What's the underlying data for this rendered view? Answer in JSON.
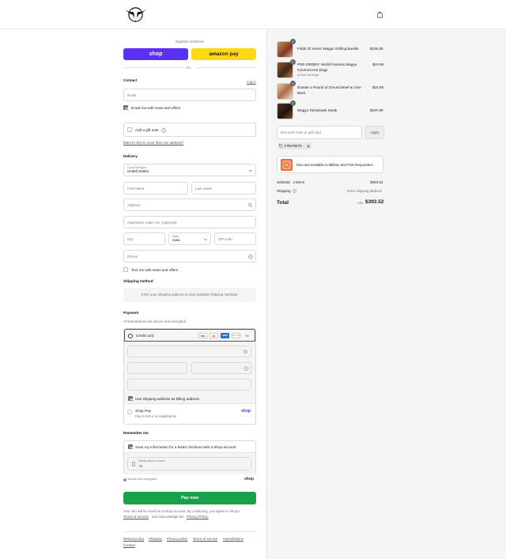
{
  "header": {
    "logo": "longhorn-logo",
    "cart_icon": "shopping-bag-icon"
  },
  "express": {
    "title": "Express checkout",
    "shop_label": "shop",
    "amazon_label": "amazon pay",
    "or_label": "OR"
  },
  "contact": {
    "title": "Contact",
    "login_label": "Log in",
    "email_placeholder": "Email",
    "email_news_label": "Email me with news and offers",
    "gift_note_label": "Add a gift note",
    "ship_multiple_link": "Want to ship to more than one address?"
  },
  "delivery": {
    "title": "Delivery",
    "country_label": "Country/Region",
    "country_value": "United States",
    "first_name_placeholder": "First name",
    "last_name_placeholder": "Last name",
    "address_placeholder": "Address",
    "apartment_placeholder": "Apartment, suite, etc. (optional)",
    "city_placeholder": "City",
    "state_label": "State",
    "state_value": "Iowa",
    "zip_placeholder": "ZIP code",
    "phone_placeholder": "Phone",
    "text_news_label": "Text me with news and offers"
  },
  "shipping_method": {
    "title": "Shipping method",
    "notice": "Enter your shipping address to view available shipping methods."
  },
  "payment": {
    "title": "Payment",
    "subtitle": "All transactions are secure and encrypted.",
    "credit_card_label": "Credit card",
    "more_cards": "+4",
    "card_logos": [
      "VISA",
      "MC",
      "AMEX",
      "DISCOVER"
    ],
    "billing_same_label": "Use shipping address as billing address",
    "shop_pay_label": "Shop Pay",
    "shop_pay_sub": "Pay in full or in installments",
    "shop_pay_logo": "shop"
  },
  "remember": {
    "title": "Remember me",
    "save_label": "Save my information for a faster checkout with a Shop account",
    "mobile_label": "Mobile phone number",
    "mobile_value": "+1",
    "secure_label": "Secure and encrypted",
    "shop_logo": "shop"
  },
  "pay_now_label": "Pay now",
  "legal": {
    "line1": "Your info will be saved to a Shop account. By continuing, you agree to Shop's",
    "terms_link": "Terms of Service",
    "and_text": "and acknowledge the",
    "privacy_link": "Privacy Policy."
  },
  "footer_links": [
    "Refund policy",
    "Shipping",
    "Privacy policy",
    "Terms of service",
    "Cancellations",
    "Contact"
  ],
  "cart": {
    "items": [
      {
        "qty": "1",
        "name": "Folds Of Honor Wagyu Grilling Bundle",
        "sub": "",
        "price": "$159.55"
      },
      {
        "qty": "1",
        "name": "PRE-ORDER: World Famous Wagyu Gourmet Hot Dogs",
        "sub": "8-Pack Hot Dogs",
        "price": "$19.99"
      },
      {
        "qty": "1",
        "name": "Donate a Pound of Ground Beef & Give Back",
        "sub": "",
        "price": "$15.99"
      },
      {
        "qty": "1",
        "name": "Wagyu Tomahawk Steak",
        "sub": "",
        "price": "$197.99"
      }
    ],
    "discount_placeholder": "Discount code or gift card",
    "apply_label": "Apply",
    "code_tag": "FIRSTBITE",
    "military_text": "Discount available to Military and First Responders.",
    "subtotal_label": "Subtotal · 4 items",
    "subtotal_value": "$393.52",
    "shipping_label": "Shipping",
    "shipping_value": "Enter shipping address",
    "total_label": "Total",
    "currency": "USD",
    "total_value": "$393.52"
  },
  "colors": {
    "shop_purple": "#5a31f4",
    "amazon_yellow": "#ffd814",
    "pay_green": "#1aa04a"
  }
}
